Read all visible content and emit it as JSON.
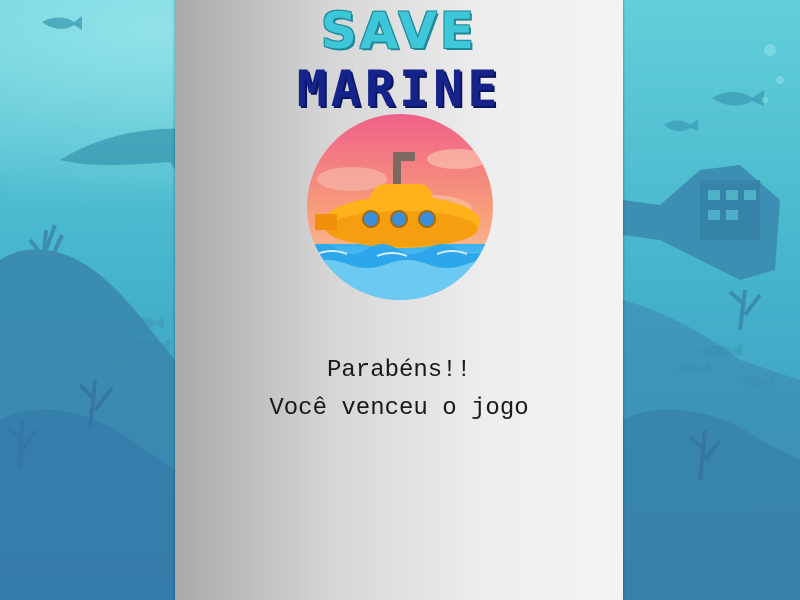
{
  "game": {
    "title_line1": "SAVE",
    "title_line2": "MARINE",
    "message_line1": "Parabéns!!",
    "message_line2": "Você venceu o jogo"
  },
  "colors": {
    "ocean": "#5cc6d4",
    "ocean_dark": "#3f9fc0",
    "panel": "#d6d6d6",
    "title_save": "#3ec7d8",
    "title_marine": "#15238a",
    "submarine": "#ffb21a",
    "sky_pink": "#f0608a"
  },
  "icons": [
    "shark-icon",
    "fish-icon",
    "shipwreck-icon",
    "coral-icon",
    "submarine-icon"
  ]
}
